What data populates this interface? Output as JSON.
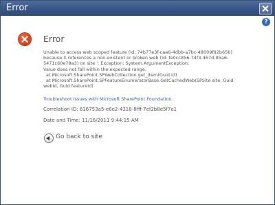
{
  "window": {
    "title": "Error"
  },
  "help_icon": "question-icon",
  "error": {
    "heading": "Error",
    "message_lines": [
      "Unable to access web scoped feature (Id: 74b77e3f-caa6-4dbb-a7bc-48009f92b656)",
      "because it references a non-existent or broken web (Id: fe0cc856-74f3-467d-85a6-",
      "5471c60e78a3) on site                              '.  Exception: System.ArgumentException:",
      "Value does not fall within the expected range.",
      "at Microsoft.SharePoint.SPWebCollection.get_Item(Guid id)",
      "at Microsoft.SharePoint.SPFeatureEnumeratorBase.GetCachedWeb(SPSite site, Guid",
      "webId, Guid featureId)"
    ],
    "troubleshoot_link": "Troubleshoot issues with Microsoft SharePoint Foundation.",
    "correlation": "Correlation ID: 616753a5-e6e2-4318-8fff-7ef2b8e5f7e1",
    "datetime": "Date and Time: 11/16/2011 9:44:15 AM"
  },
  "actions": {
    "go_back_label": "Go back to site"
  },
  "colors": {
    "titlebar": "#3c5a89",
    "link": "#2f5fa6",
    "error_icon": "#d6401a"
  }
}
